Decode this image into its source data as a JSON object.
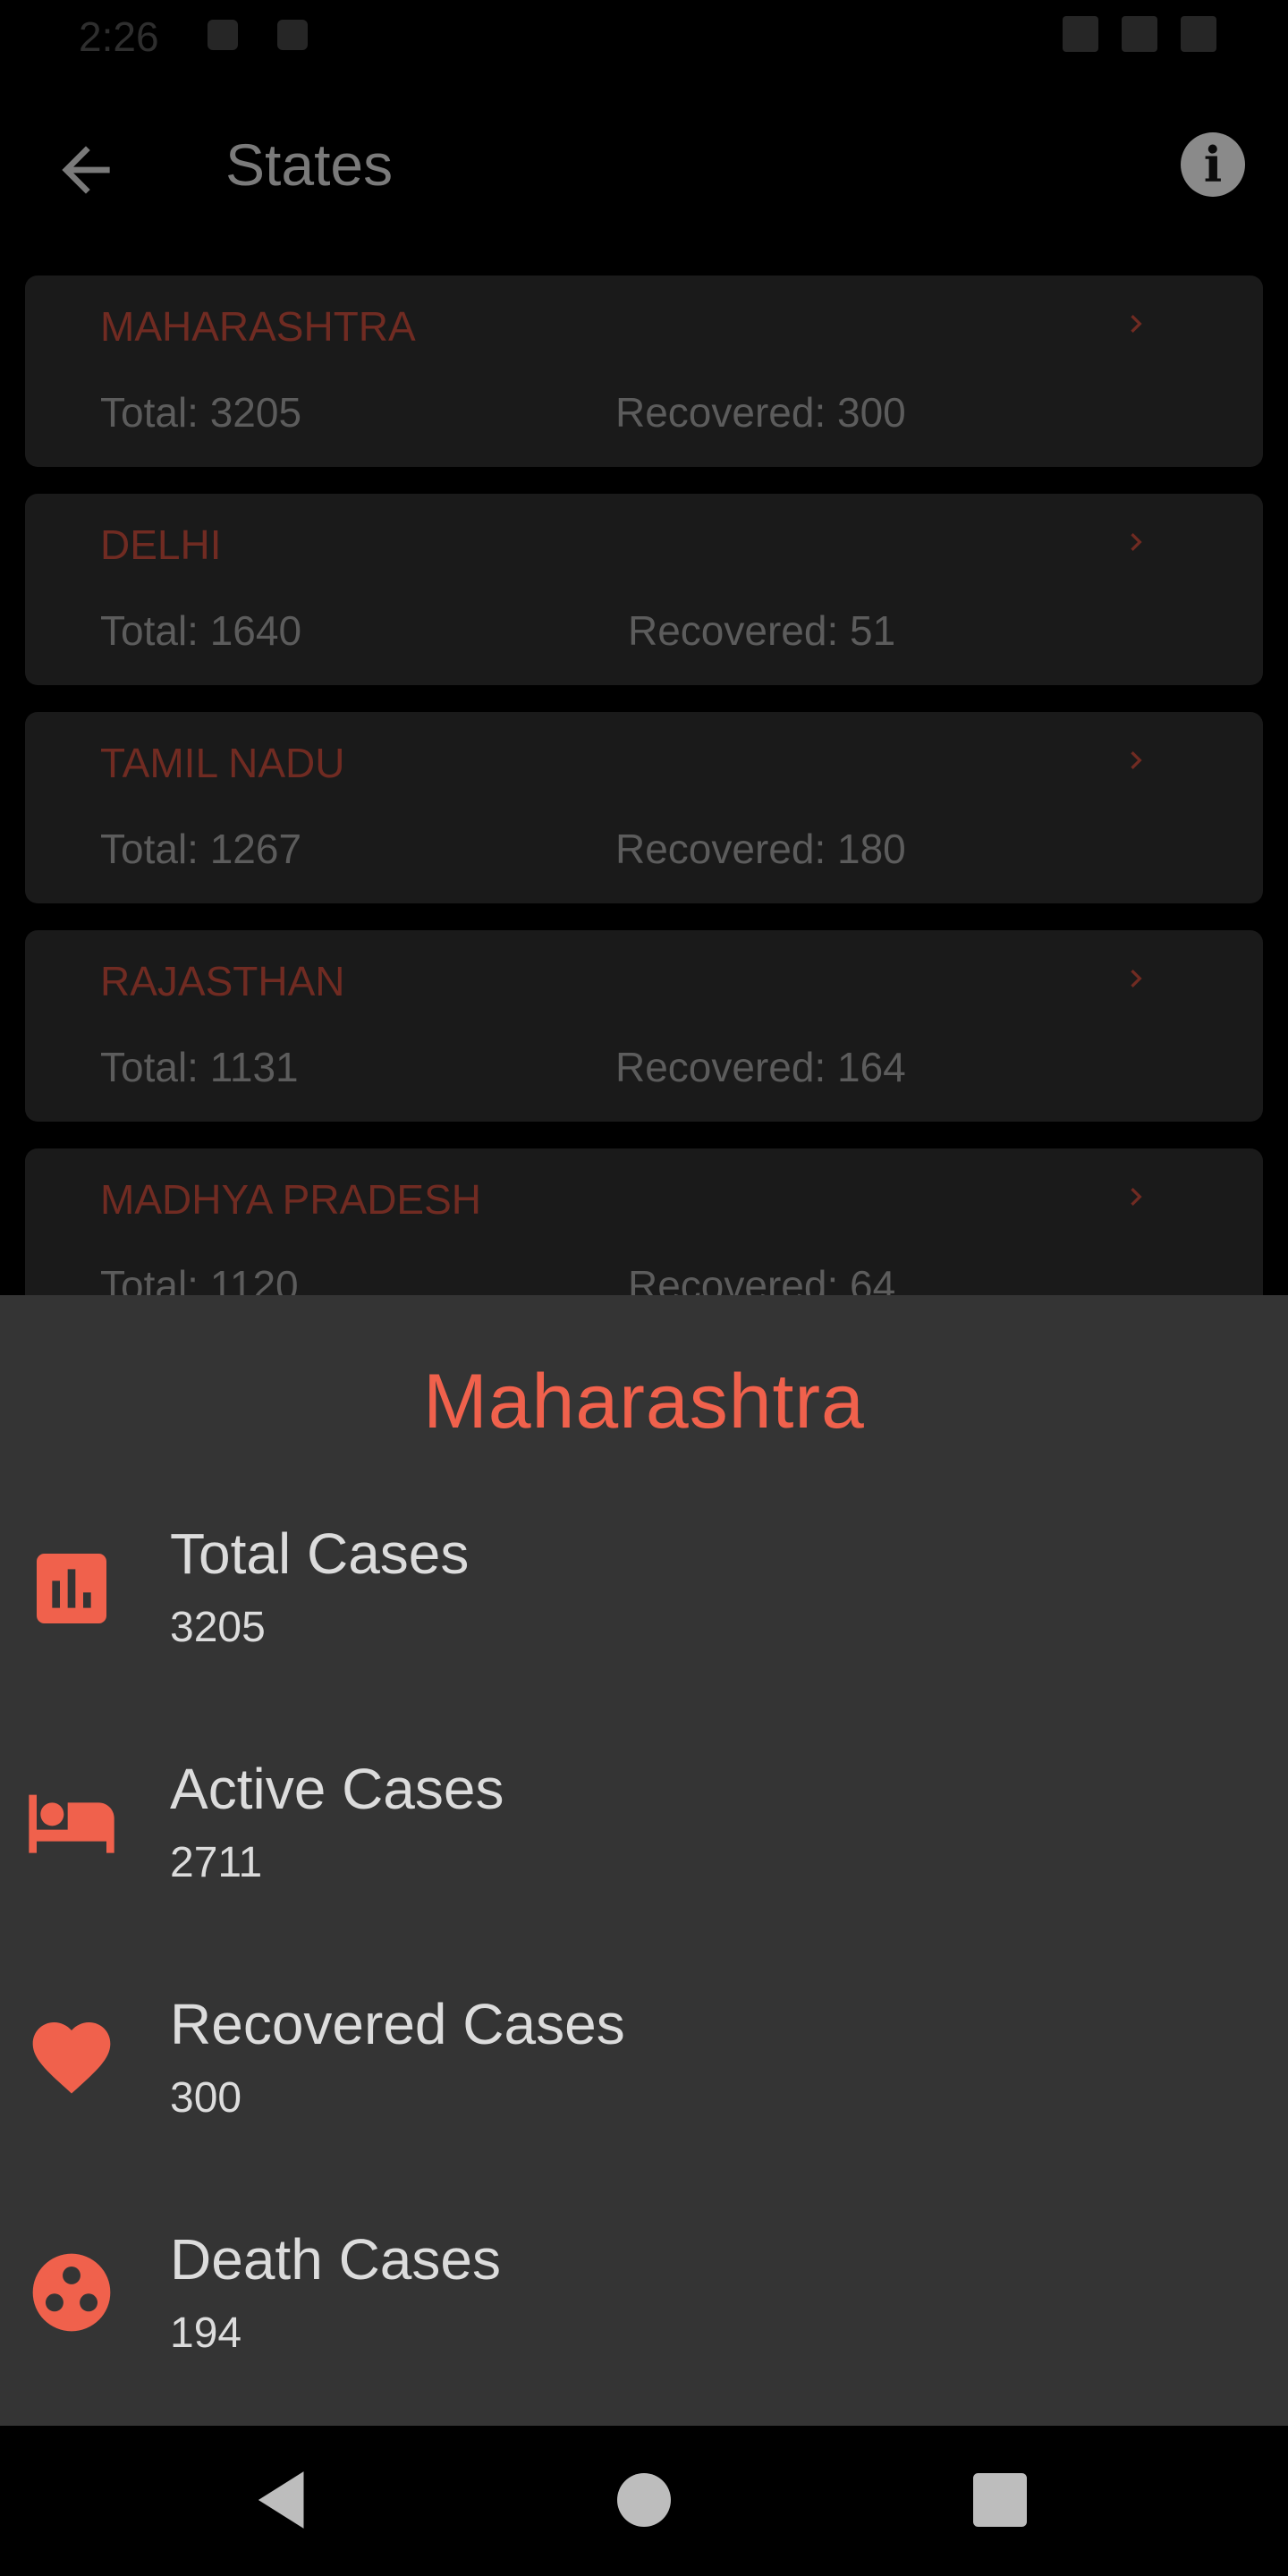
{
  "status_bar": {
    "time": "2:26"
  },
  "app_bar": {
    "title": "States"
  },
  "states": [
    {
      "name": "MAHARASHTRA",
      "total": "Total: 3205",
      "recovered": "Recovered: 300"
    },
    {
      "name": "DELHI",
      "total": "Total: 1640",
      "recovered": "Recovered: 51"
    },
    {
      "name": "TAMIL NADU",
      "total": "Total: 1267",
      "recovered": "Recovered: 180"
    },
    {
      "name": "RAJASTHAN",
      "total": "Total: 1131",
      "recovered": "Recovered: 164"
    },
    {
      "name": "MADHYA PRADESH",
      "total": "Total: 1120",
      "recovered": "Recovered: 64"
    }
  ],
  "sheet": {
    "title": "Maharashtra",
    "stats": [
      {
        "label": "Total Cases",
        "value": "3205",
        "icon": "bar-chart-icon"
      },
      {
        "label": "Active Cases",
        "value": "2711",
        "icon": "bed-icon"
      },
      {
        "label": "Recovered Cases",
        "value": "300",
        "icon": "heart-icon"
      },
      {
        "label": "Death Cases",
        "value": "194",
        "icon": "virus-icon"
      }
    ]
  },
  "colors": {
    "accent": "#f0614c",
    "sheet_bg": "#343434",
    "card_bg": "#1a1a1a"
  }
}
